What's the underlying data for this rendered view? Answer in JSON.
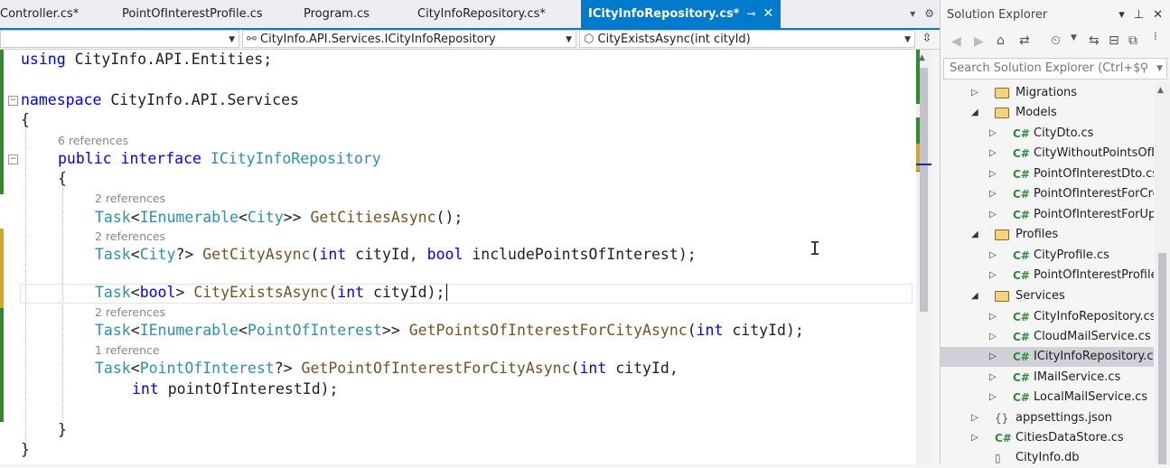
{
  "tabs": [
    {
      "label": "Controller.cs*",
      "active": false
    },
    {
      "label": "PointOfInterestProfile.cs",
      "active": false
    },
    {
      "label": "Program.cs",
      "active": false
    },
    {
      "label": "CityInfoRepository.cs*",
      "active": false
    },
    {
      "label": "ICityInfoRepository.cs*",
      "active": true
    }
  ],
  "tab_icons": {
    "pin": "pin-icon",
    "close": "close-icon",
    "menu": "dropdown-icon",
    "settings": "gear-icon"
  },
  "navbar": {
    "type_scope": "CityInfo.API.Services.ICityInfoRepository",
    "member": "CityExistsAsync(int cityId)"
  },
  "code": {
    "using_kw": "using",
    "using_ns": " CityInfo.API.Entities;",
    "namespace_kw": "namespace",
    "namespace_name": " CityInfo.API.Services",
    "brace_open": "{",
    "brace_close": "}",
    "lens_iface": "6 references",
    "iface_mods": "public interface",
    "iface_name": "ICityInfoRepository",
    "lens_m1": "2 references",
    "lens_m2": "2 references",
    "lens_m4": "2 references",
    "lens_m5": "1 reference",
    "task": "Task",
    "ienumerable": "IEnumerable",
    "city": "City",
    "poi": "PointOfInterest",
    "m1_name": "GetCitiesAsync",
    "m1_args": "();",
    "m2_name": "GetCityAsync",
    "m3_name": "CityExistsAsync",
    "m4_name": "GetPointsOfInterestForCityAsync",
    "m5_name": "GetPointOfInterestForCityAsync",
    "kw_int": "int",
    "kw_bool": "bool",
    "p_cityId": " cityId",
    "p_include": " includePointsOfInterest",
    "p_poiId": " pointOfInterestId"
  },
  "solution_explorer": {
    "title": "Solution Explorer",
    "search_placeholder": "Search Solution Explorer (Ctrl+$)",
    "items": [
      {
        "label": "Migrations",
        "kind": "folder",
        "expanded": false
      },
      {
        "label": "Models",
        "kind": "folder",
        "expanded": true
      },
      {
        "label": "CityDto.cs",
        "kind": "cs"
      },
      {
        "label": "CityWithoutPointsOfI",
        "kind": "cs"
      },
      {
        "label": "PointOfInterestDto.cs",
        "kind": "cs"
      },
      {
        "label": "PointOfInterestForCre",
        "kind": "cs"
      },
      {
        "label": "PointOfInterestForUp",
        "kind": "cs"
      },
      {
        "label": "Profiles",
        "kind": "folder",
        "expanded": true
      },
      {
        "label": "CityProfile.cs",
        "kind": "cs"
      },
      {
        "label": "PointOfInterestProfile",
        "kind": "cs"
      },
      {
        "label": "Services",
        "kind": "folder",
        "expanded": true
      },
      {
        "label": "CityInfoRepository.cs",
        "kind": "cs"
      },
      {
        "label": "CloudMailService.cs",
        "kind": "cs"
      },
      {
        "label": "ICityInfoRepository.cs",
        "kind": "cs",
        "selected": true
      },
      {
        "label": "IMailService.cs",
        "kind": "cs"
      },
      {
        "label": "LocalMailService.cs",
        "kind": "cs"
      },
      {
        "label": "appsettings.json",
        "kind": "json"
      },
      {
        "label": "CitiesDataStore.cs",
        "kind": "cs"
      },
      {
        "label": "CityInfo.db",
        "kind": "file"
      }
    ]
  },
  "colors": {
    "accent": "#007acc",
    "keyword": "#0000ff",
    "type": "#2b91af",
    "method": "#74531f",
    "change_saved": "#2f8a2f",
    "change_unsaved": "#d6a62a"
  }
}
